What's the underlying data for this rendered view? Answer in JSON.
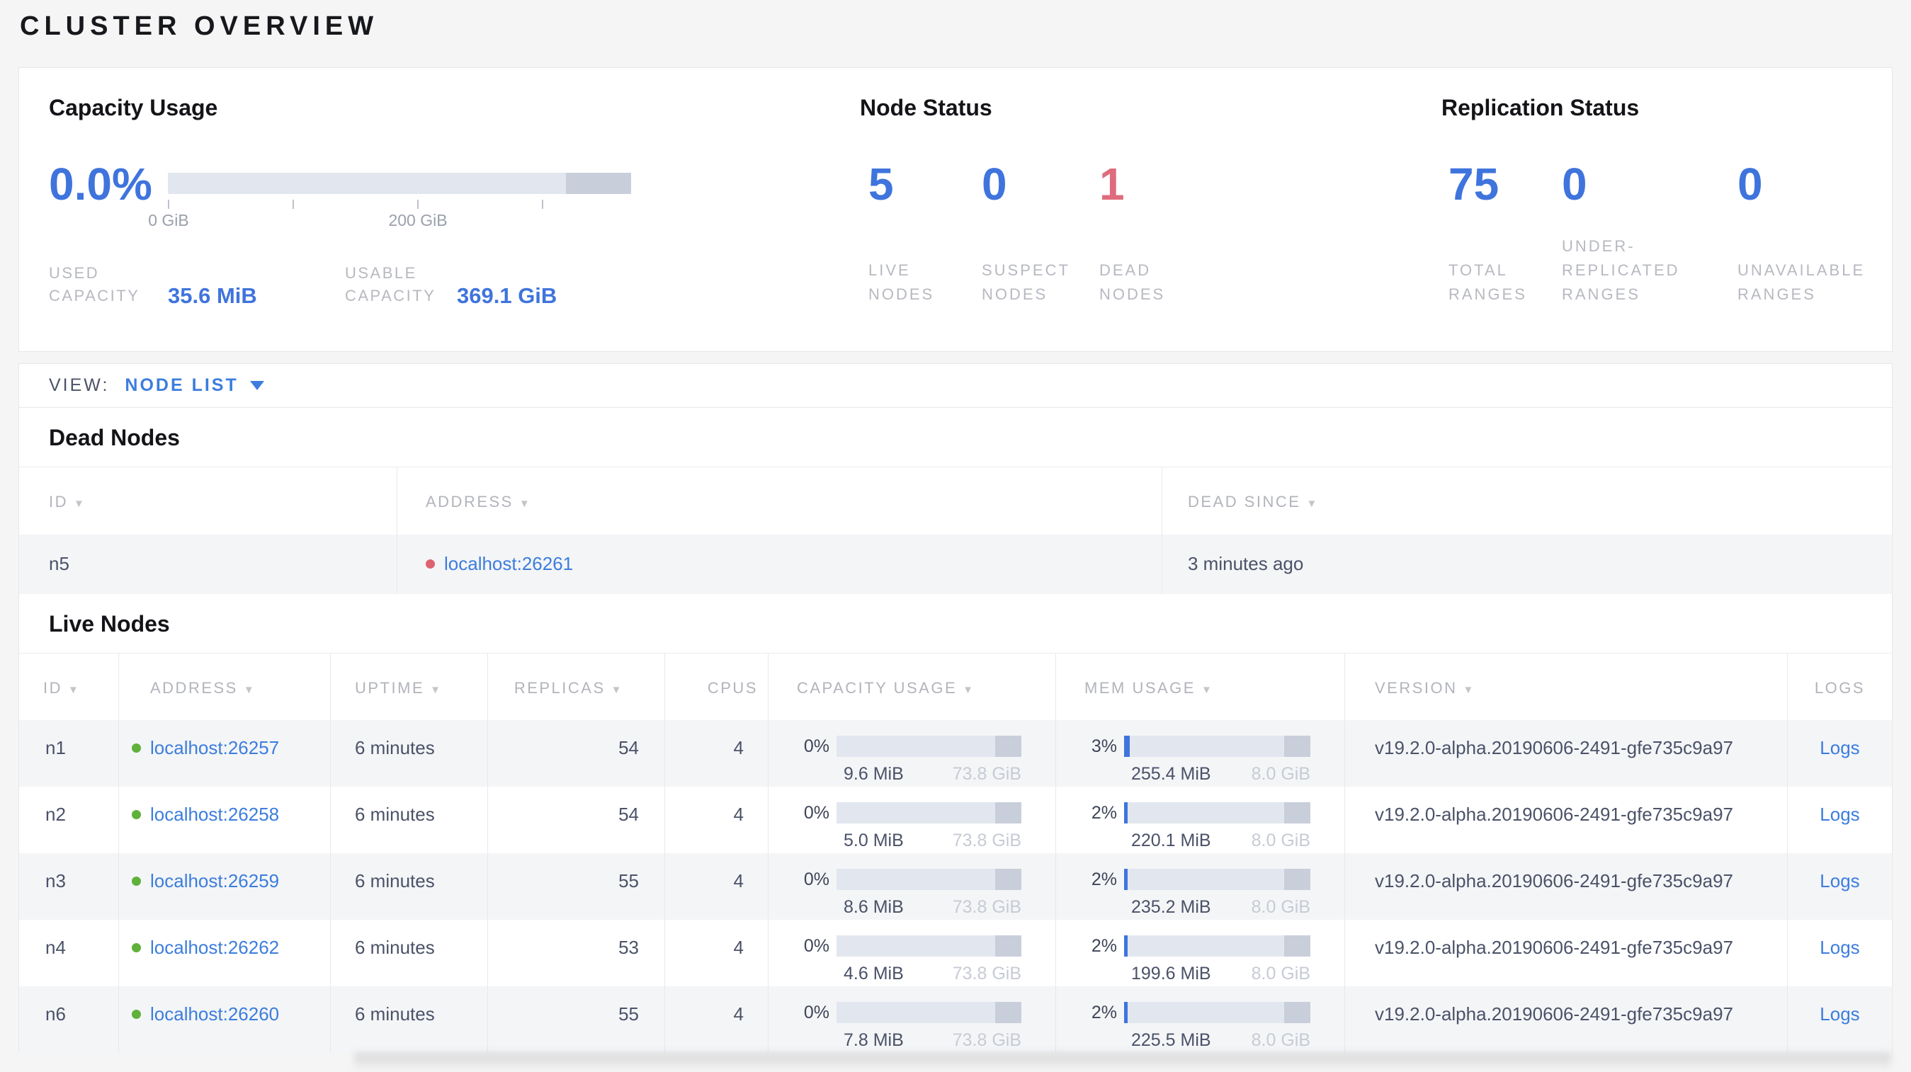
{
  "page": {
    "title": "CLUSTER OVERVIEW"
  },
  "colors": {
    "accent_blue": "#3f74dd",
    "link_blue": "#3c7dde",
    "danger_red": "#de6c7c",
    "live_green": "#5fb13a",
    "dead_red": "#dd6370"
  },
  "overview": {
    "capacity": {
      "title": "Capacity Usage",
      "percent": "0.0%",
      "tick_labels": [
        "0 GiB",
        "200 GiB"
      ],
      "used_label_lines": [
        "USED",
        "CAPACITY"
      ],
      "used_value": "35.6 MiB",
      "usable_label_lines": [
        "USABLE",
        "CAPACITY"
      ],
      "usable_value": "369.1 GiB",
      "bar": {
        "used_pct": 0,
        "reserved_pct": 14
      }
    },
    "node_status": {
      "title": "Node Status",
      "stats": [
        {
          "value": "5",
          "label_lines": [
            "LIVE",
            "NODES"
          ]
        },
        {
          "value": "0",
          "label_lines": [
            "SUSPECT",
            "NODES"
          ]
        },
        {
          "value": "1",
          "label_lines": [
            "DEAD",
            "NODES"
          ]
        }
      ]
    },
    "replication": {
      "title": "Replication Status",
      "stats": [
        {
          "value": "75",
          "label_lines": [
            "TOTAL",
            "RANGES"
          ]
        },
        {
          "value": "0",
          "label_lines": [
            "UNDER-",
            "REPLICATED",
            "RANGES"
          ]
        },
        {
          "value": "0",
          "label_lines": [
            "UNAVAILABLE",
            "RANGES"
          ]
        }
      ]
    }
  },
  "view_bar": {
    "label": "VIEW:",
    "value": "NODE LIST"
  },
  "dead_nodes": {
    "title": "Dead Nodes",
    "columns": [
      {
        "label": "ID"
      },
      {
        "label": "ADDRESS"
      },
      {
        "label": "DEAD SINCE"
      }
    ],
    "rows": [
      {
        "id": "n5",
        "address": "localhost:26261",
        "dead_since": "3 minutes ago"
      }
    ]
  },
  "live_nodes": {
    "title": "Live Nodes",
    "columns": [
      {
        "label": "ID",
        "sortable": true
      },
      {
        "label": "ADDRESS",
        "sortable": true
      },
      {
        "label": "UPTIME",
        "sortable": true
      },
      {
        "label": "REPLICAS",
        "sortable": true
      },
      {
        "label": "CPUS",
        "sortable": false
      },
      {
        "label": "CAPACITY USAGE",
        "sortable": true
      },
      {
        "label": "MEM USAGE",
        "sortable": true
      },
      {
        "label": "VERSION",
        "sortable": true
      },
      {
        "label": "LOGS",
        "sortable": false
      }
    ],
    "rows": [
      {
        "id": "n1",
        "address": "localhost:26257",
        "uptime": "6 minutes",
        "replicas": "54",
        "cpus": "4",
        "capacity": {
          "percent_label": "0%",
          "pct": 0,
          "used": "9.6 MiB",
          "total": "73.8 GiB"
        },
        "mem": {
          "percent_label": "3%",
          "pct": 3,
          "used": "255.4 MiB",
          "total": "8.0 GiB"
        },
        "version": "v19.2.0-alpha.20190606-2491-gfe735c9a97",
        "logs_label": "Logs"
      },
      {
        "id": "n2",
        "address": "localhost:26258",
        "uptime": "6 minutes",
        "replicas": "54",
        "cpus": "4",
        "capacity": {
          "percent_label": "0%",
          "pct": 0,
          "used": "5.0 MiB",
          "total": "73.8 GiB"
        },
        "mem": {
          "percent_label": "2%",
          "pct": 2,
          "used": "220.1 MiB",
          "total": "8.0 GiB"
        },
        "version": "v19.2.0-alpha.20190606-2491-gfe735c9a97",
        "logs_label": "Logs"
      },
      {
        "id": "n3",
        "address": "localhost:26259",
        "uptime": "6 minutes",
        "replicas": "55",
        "cpus": "4",
        "capacity": {
          "percent_label": "0%",
          "pct": 0,
          "used": "8.6 MiB",
          "total": "73.8 GiB"
        },
        "mem": {
          "percent_label": "2%",
          "pct": 2,
          "used": "235.2 MiB",
          "total": "8.0 GiB"
        },
        "version": "v19.2.0-alpha.20190606-2491-gfe735c9a97",
        "logs_label": "Logs"
      },
      {
        "id": "n4",
        "address": "localhost:26262",
        "uptime": "6 minutes",
        "replicas": "53",
        "cpus": "4",
        "capacity": {
          "percent_label": "0%",
          "pct": 0,
          "used": "4.6 MiB",
          "total": "73.8 GiB"
        },
        "mem": {
          "percent_label": "2%",
          "pct": 2,
          "used": "199.6 MiB",
          "total": "8.0 GiB"
        },
        "version": "v19.2.0-alpha.20190606-2491-gfe735c9a97",
        "logs_label": "Logs"
      },
      {
        "id": "n6",
        "address": "localhost:26260",
        "uptime": "6 minutes",
        "replicas": "55",
        "cpus": "4",
        "capacity": {
          "percent_label": "0%",
          "pct": 0,
          "used": "7.8 MiB",
          "total": "73.8 GiB"
        },
        "mem": {
          "percent_label": "2%",
          "pct": 2,
          "used": "225.5 MiB",
          "total": "8.0 GiB"
        },
        "version": "v19.2.0-alpha.20190606-2491-gfe735c9a97",
        "logs_label": "Logs"
      }
    ]
  }
}
